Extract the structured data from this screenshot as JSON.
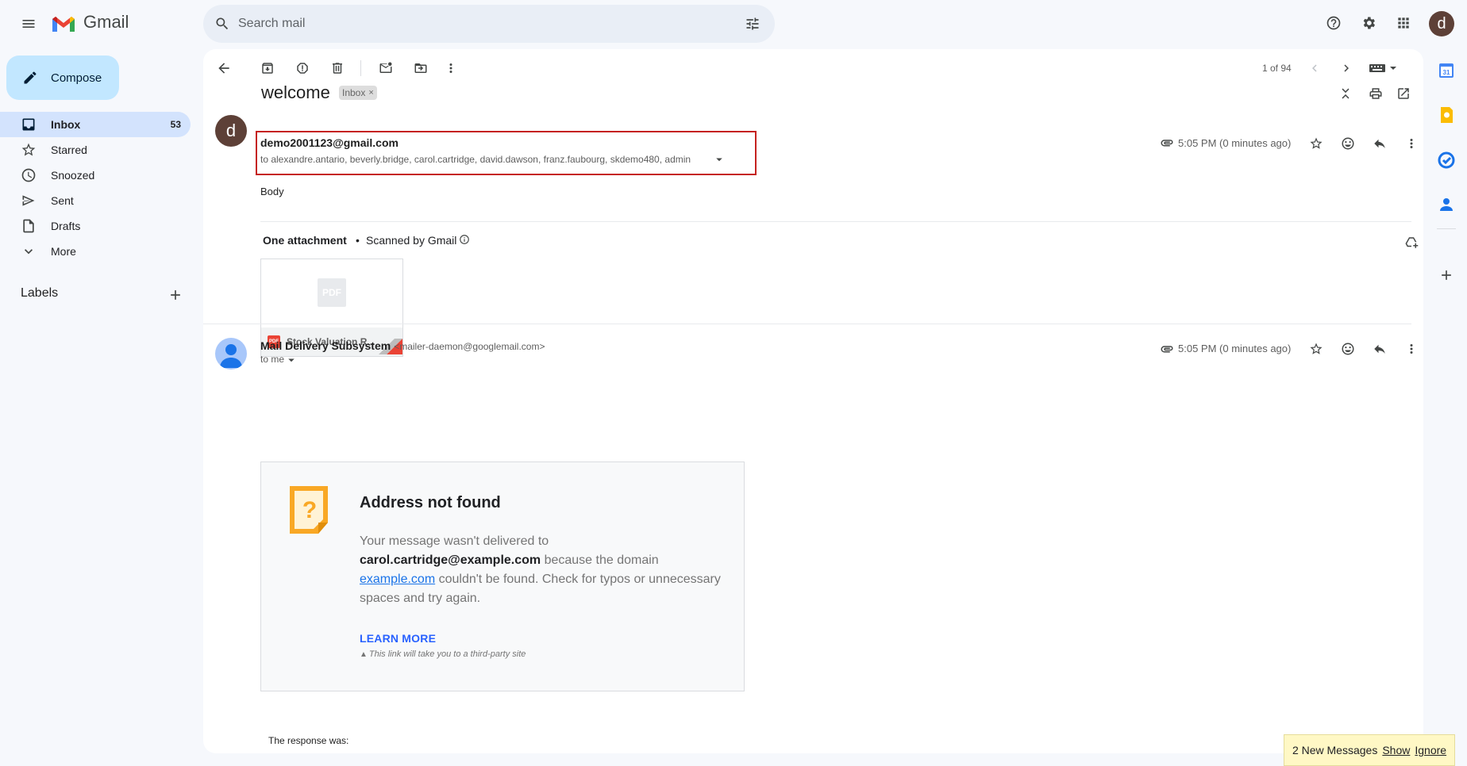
{
  "app": {
    "name": "Gmail",
    "account_initial": "d"
  },
  "search": {
    "placeholder": "Search mail"
  },
  "sidebar": {
    "compose_label": "Compose",
    "items": [
      {
        "label": "Inbox",
        "count": "53",
        "icon": "inbox-icon",
        "active": true
      },
      {
        "label": "Starred",
        "count": "",
        "icon": "star-icon"
      },
      {
        "label": "Snoozed",
        "count": "",
        "icon": "clock-icon"
      },
      {
        "label": "Sent",
        "count": "",
        "icon": "send-icon"
      },
      {
        "label": "Drafts",
        "count": "",
        "icon": "draft-icon"
      },
      {
        "label": "More",
        "count": "",
        "icon": "chevron-down-icon"
      }
    ],
    "labels_heading": "Labels"
  },
  "toolbar": {
    "pagination": "1 of 94"
  },
  "thread": {
    "subject": "welcome",
    "label_chip": "Inbox",
    "messages": [
      {
        "avatar_initial": "d",
        "sender": "demo2001123@gmail.com",
        "recipients": "to alexandre.antario, beverly.bridge, carol.cartridge, david.dawson, franz.faubourg, skdemo480, admin",
        "time": "5:05 PM (0 minutes ago)",
        "body": "Body",
        "attachment_heading": "One attachment",
        "scanned": "Scanned by Gmail",
        "attachment_name": "Stock Valuation R...",
        "attachment_type": "PDF"
      },
      {
        "sender": "Mail Delivery Subsystem",
        "sender_email": "<mailer-daemon@googlemail.com>",
        "recipients": "to me",
        "time": "5:05 PM (0 minutes ago)",
        "bounce": {
          "title": "Address not found",
          "text_1": "Your message wasn't delivered to",
          "address": "carol.cartridge@example.com",
          "text_2": " because the domain",
          "domain_link": "example.com",
          "text_3": " couldn't be found. Check for typos or unnecessary spaces and try again.",
          "learn_more": "LEARN MORE",
          "third_party_note": "This link will take you to a third-party site"
        },
        "response_label": "The response was:"
      }
    ]
  },
  "toast": {
    "text": "2 New Messages",
    "show": "Show",
    "ignore": "Ignore"
  },
  "colors": {
    "highlight_box": "#c5221f",
    "accent": "#0b57d0",
    "compose_bg": "#c2e7ff",
    "active_nav_bg": "#d3e3fd",
    "avatar_bg": "#5d4037"
  }
}
